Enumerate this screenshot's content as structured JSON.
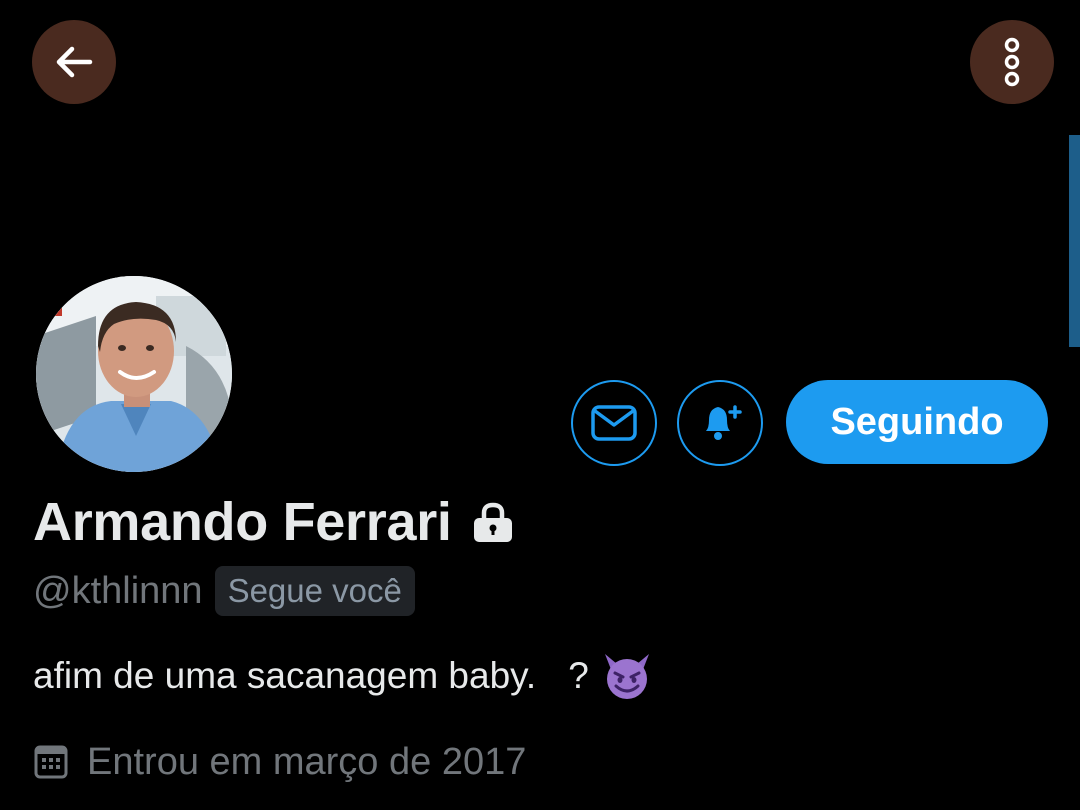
{
  "header": {
    "back_icon": "arrow-left-icon",
    "more_icon": "more-vertical-icon"
  },
  "profile": {
    "display_name": "Armando Ferrari",
    "protected_icon": "lock-icon",
    "handle": "@kthlinnn",
    "follows_you_label": "Segue você",
    "bio_text": "afim de uma sacanagem baby.",
    "bio_suffix": "?",
    "bio_emoji": "smiling-imp-emoji",
    "joined_icon": "calendar-icon",
    "joined_text": "Entrou em março de 2017"
  },
  "actions": {
    "message_icon": "mail-icon",
    "notify_icon": "bell-plus-icon",
    "following_label": "Seguindo"
  },
  "colors": {
    "accent": "#1d9bf0",
    "background": "#000000",
    "primary_text": "#e7e9ea",
    "secondary_text": "#71767b"
  }
}
